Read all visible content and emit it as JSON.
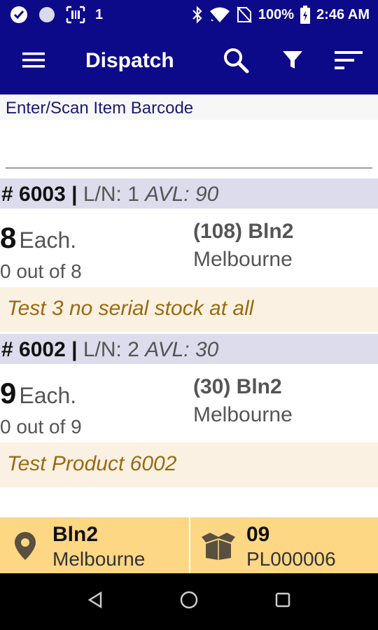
{
  "status_bar": {
    "notification_count": "1",
    "battery": "100%",
    "time": "2:46 AM"
  },
  "app_bar": {
    "title": "Dispatch",
    "icons": [
      "menu-icon",
      "search-icon",
      "filter-icon",
      "sort-icon"
    ]
  },
  "scan": {
    "label": "Enter/Scan Item Barcode",
    "value": "",
    "placeholder": ""
  },
  "items": [
    {
      "number": "# 6003",
      "separator": "|",
      "line": "L/N: 1",
      "available": "AVL: 90",
      "qty": "8",
      "unit": "Each.",
      "progress": "0 out of 8",
      "bin": "(108) Bln2",
      "location": "Melbourne",
      "description": "Test 3 no serial stock at all"
    },
    {
      "number": "# 6002",
      "separator": "|",
      "line": "L/N: 2",
      "available": "AVL: 30",
      "qty": "9",
      "unit": "Each.",
      "progress": "0 out of 9",
      "bin": "(30) Bln2",
      "location": "Melbourne",
      "description": "Test Product 6002"
    }
  ],
  "footer": {
    "bin": "Bln2",
    "location": "Melbourne",
    "count": "09",
    "pick_list": "PL000006"
  },
  "colors": {
    "primary": "#0d0a8a",
    "item_header_bg": "#dcdcec",
    "description_bg": "#fbf1e3",
    "description_text": "#9a6a10",
    "footer_bg": "#fdd784"
  }
}
